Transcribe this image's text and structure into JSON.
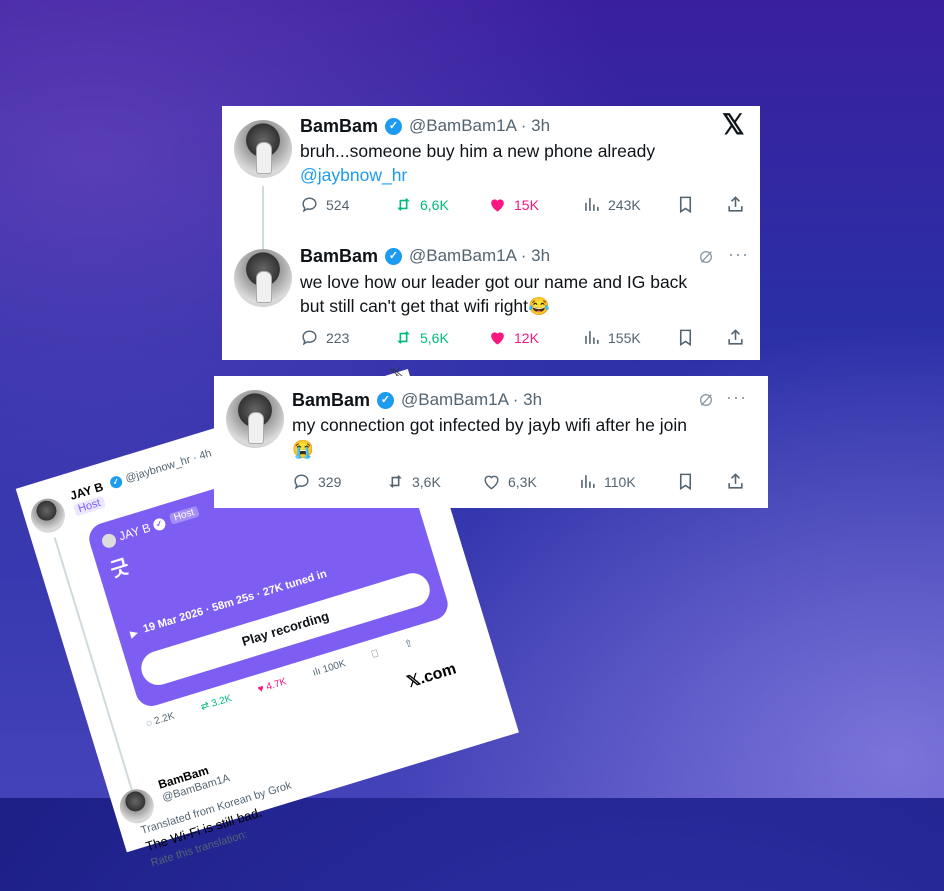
{
  "tweet1": {
    "name": "BamBam",
    "handle": "@BamBam1A · 3h",
    "line1": "bruh...someone buy him a new phone already",
    "mention": "@jaybnow_hr",
    "replies": "524",
    "reposts": "6,6K",
    "likes": "15K",
    "views": "243K",
    "logo": "𝕏"
  },
  "tweet2": {
    "name": "BamBam",
    "handle": "@BamBam1A · 3h",
    "line1": "we love how our leader got our name and IG back",
    "line2": "but still can't get that wifi right😂",
    "replies": "223",
    "reposts": "5,6K",
    "likes": "12K",
    "views": "155K",
    "more": "···"
  },
  "tweet3": {
    "name": "BamBam",
    "handle": "@BamBam1A · 3h",
    "line1": "my connection got infected by jayb wifi after he join",
    "line2": "😭",
    "replies": "329",
    "reposts": "3,6K",
    "likes": "6,3K",
    "views": "110K",
    "more": "···"
  },
  "rotated": {
    "x_small": "𝕏",
    "author": "JAY B",
    "author_handle": "@jaybnow_hr · 4h",
    "host_badge": "Host",
    "space_host": "JAY B",
    "space_host_badge": "Host",
    "space_title": "긋",
    "space_meta": "19 Mar 2026 · 58m 25s · 27K tuned in",
    "play_label": "Play recording",
    "replies": "2.2K",
    "reposts": "3.2K",
    "likes": "4.7K",
    "views": "100K",
    "site": "𝕏.com",
    "reply_name": "BamBam",
    "reply_handle": "@BamBam1A",
    "translated": "Translated from Korean by Grok",
    "reply_text": "The Wi-Fi is still bad.",
    "rate": "Rate this translation:"
  },
  "colors": {
    "verified": "#1d9bf0",
    "repost": "#00ba7c",
    "like": "#f91880",
    "space": "#7e5ef2"
  }
}
